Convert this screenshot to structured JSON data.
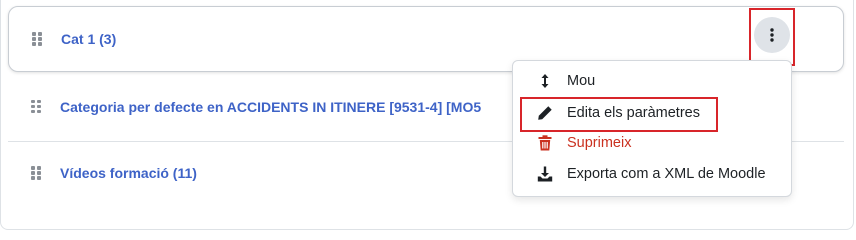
{
  "categories": [
    {
      "label": "Cat 1 (3)"
    },
    {
      "label": "Categoria per defecte en ACCIDENTS IN ITINERE [9531-4] [MO5"
    },
    {
      "label": "Vídeos formació (11)"
    }
  ],
  "actions_menu": {
    "items": [
      {
        "label": "Mou",
        "icon": "move-icon"
      },
      {
        "label": "Edita els paràmetres",
        "icon": "pencil-icon"
      },
      {
        "label": "Suprimeix",
        "icon": "trash-icon"
      },
      {
        "label": "Exporta com a XML de Moodle",
        "icon": "download-icon"
      }
    ]
  },
  "colors": {
    "link": "#3e63c7",
    "danger": "#ca3120",
    "highlight": "#d8252a",
    "kebab_bg": "#dfe3e8"
  }
}
